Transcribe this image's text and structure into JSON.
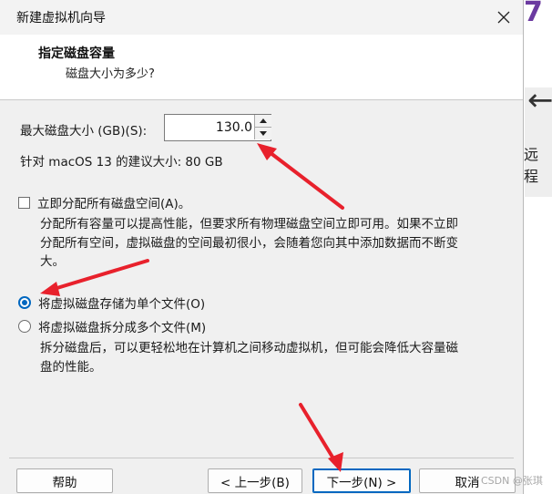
{
  "background": {
    "digit": "7",
    "label": "远程"
  },
  "window": {
    "title": "新建虚拟机向导"
  },
  "header": {
    "title": "指定磁盘容量",
    "subtitle": "磁盘大小为多少?"
  },
  "disk_size": {
    "label": "最大磁盘大小 (GB)(S):",
    "value": "130.0"
  },
  "recommendation": "针对 macOS 13 的建议大小: 80 GB",
  "allocate": {
    "label": "立即分配所有磁盘空间(A)。",
    "checked": false,
    "description_lines": [
      "分配所有容量可以提高性能，但要求所有物理磁盘空间立即可用。如果不立即",
      "分配所有空间，虚拟磁盘的空间最初很小，会随着您向其中添加数据而不断变",
      "大。"
    ]
  },
  "options": [
    {
      "label": "将虚拟磁盘存储为单个文件(O)",
      "selected": true
    },
    {
      "label": "将虚拟磁盘拆分成多个文件(M)",
      "selected": false
    }
  ],
  "split_description_lines": [
    "拆分磁盘后，可以更轻松地在计算机之间移动虚拟机，但可能会降低大容量磁",
    "盘的性能。"
  ],
  "buttons": {
    "help": "帮助",
    "back": "< 上一步(B)",
    "next": "下一步(N) >",
    "cancel": "取消"
  },
  "watermark": "CSDN @张琪",
  "colors": {
    "accent": "#0067c0",
    "annotation": "#e8212c"
  },
  "icons": {
    "close": "close-icon",
    "spin_up": "chevron-up-icon",
    "spin_down": "chevron-down-icon",
    "arrow": "arrow-left-icon"
  }
}
